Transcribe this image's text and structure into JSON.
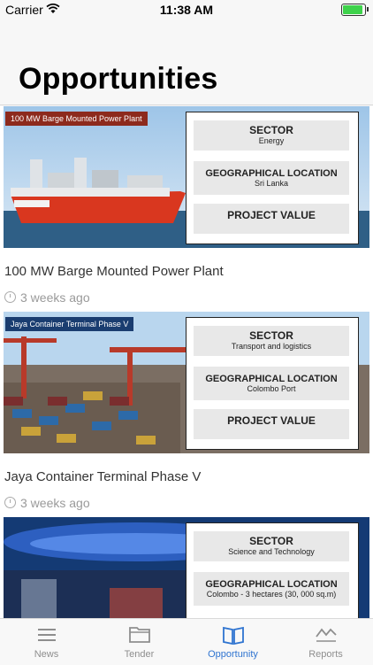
{
  "status": {
    "carrier": "Carrier",
    "time": "11:38 AM"
  },
  "page": {
    "title": "Opportunities"
  },
  "cards": [
    {
      "tag": "100 MW Barge Mounted Power Plant",
      "sector_label": "SECTOR",
      "sector": "Energy",
      "location_label": "GEOGRAPHICAL LOCATION",
      "location": "Sri Lanka",
      "value_label": "PROJECT VALUE",
      "title": "100 MW Barge Mounted Power Plant",
      "time": "3 weeks ago"
    },
    {
      "tag": "Jaya Container Terminal Phase V",
      "sector_label": "SECTOR",
      "sector": "Transport and logistics",
      "location_label": "GEOGRAPHICAL LOCATION",
      "location": "Colombo Port",
      "value_label": "PROJECT VALUE",
      "title": "Jaya Container Terminal Phase V",
      "time": "3 weeks ago"
    },
    {
      "sector_label": "SECTOR",
      "sector": "Science and Technology",
      "location_label": "GEOGRAPHICAL LOCATION",
      "location": "Colombo - 3 hectares (30, 000 sq.m)"
    }
  ],
  "tabs": [
    {
      "label": "News",
      "icon": "list-icon"
    },
    {
      "label": "Tender",
      "icon": "folder-icon"
    },
    {
      "label": "Opportunity",
      "icon": "book-icon",
      "active": true
    },
    {
      "label": "Reports",
      "icon": "chart-icon"
    }
  ],
  "colors": {
    "accent": "#2f74d0",
    "battery": "#3ed24b",
    "tag_red": "#8d2a1d",
    "tag_blue": "#1a3d70"
  }
}
